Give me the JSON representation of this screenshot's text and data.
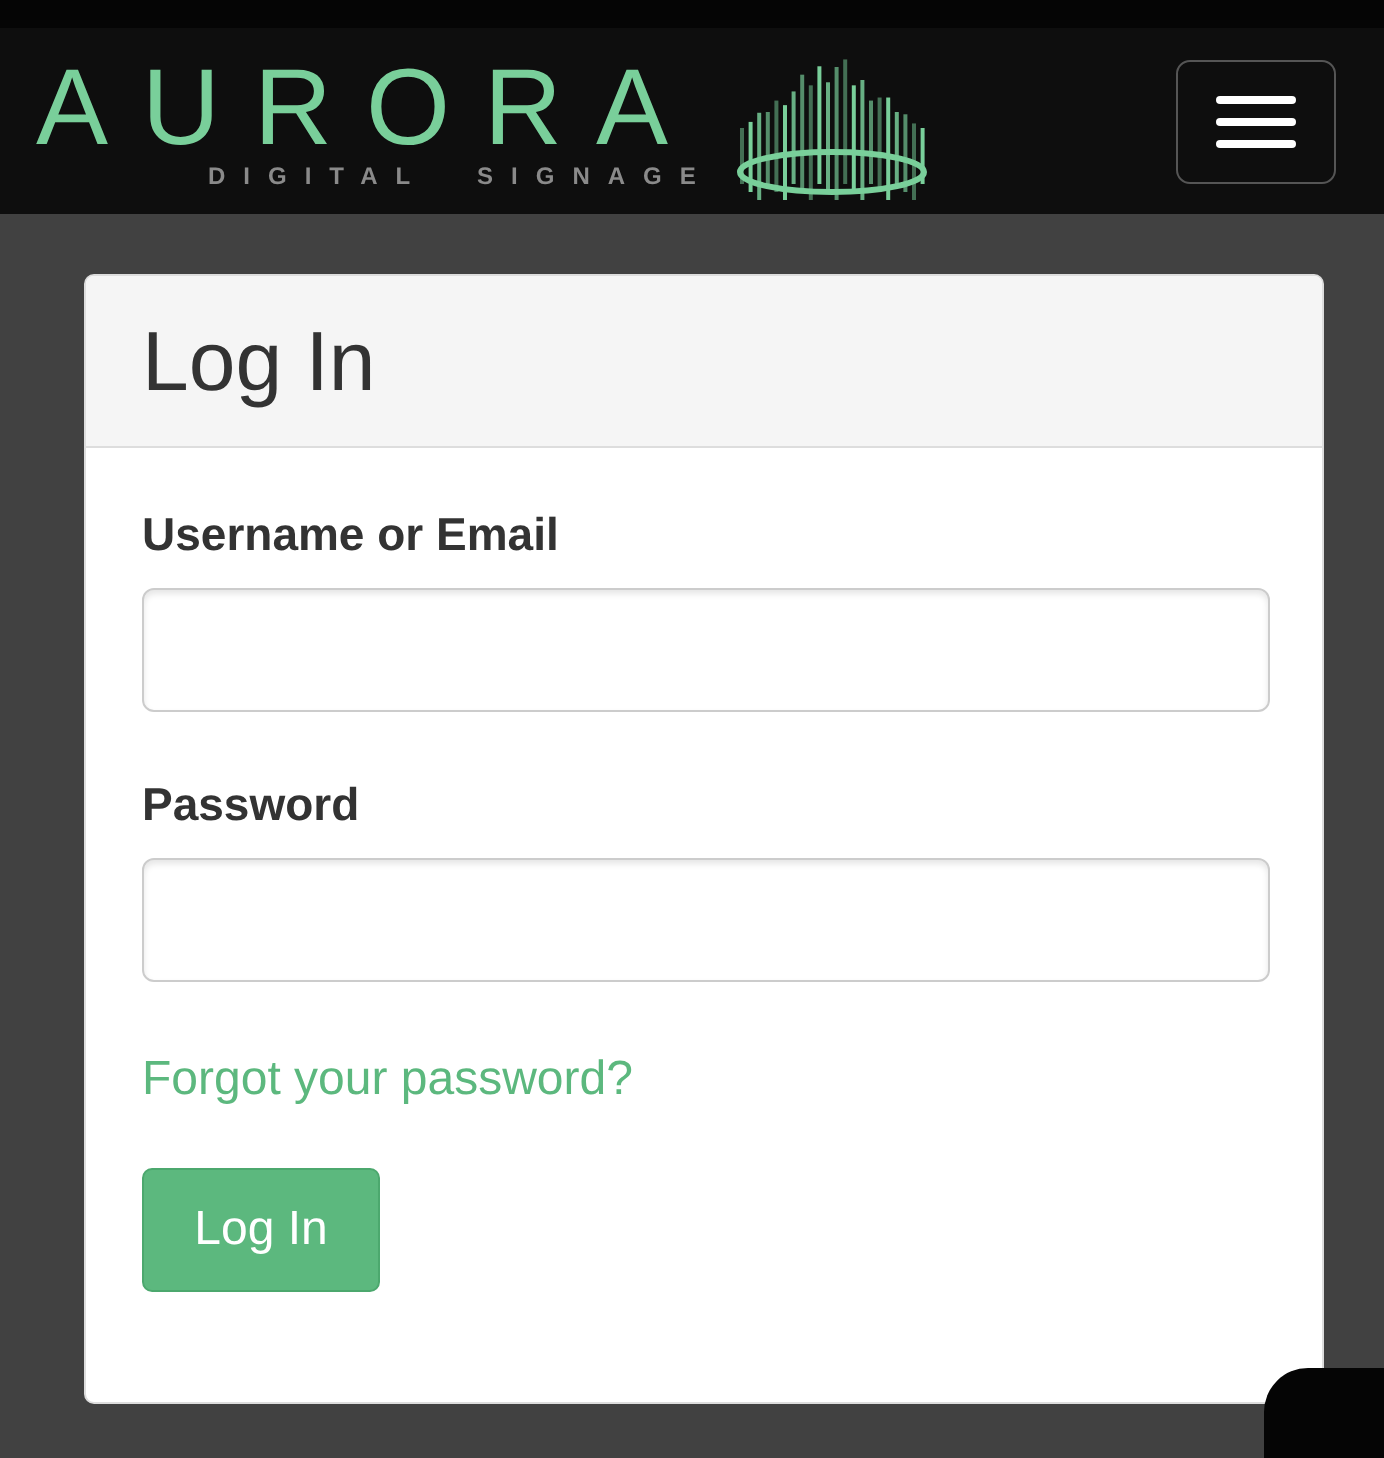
{
  "header": {
    "logo": {
      "title": "AURORA",
      "subtitle": "DIGITAL  SIGNAGE"
    },
    "menu_button": {
      "expanded": false
    }
  },
  "login_card": {
    "title": "Log In",
    "fields": [
      {
        "label": "Username or Email"
      },
      {
        "label": "Password"
      }
    ],
    "forgot_link": "Forgot your password?",
    "submit_button": "Log In"
  }
}
